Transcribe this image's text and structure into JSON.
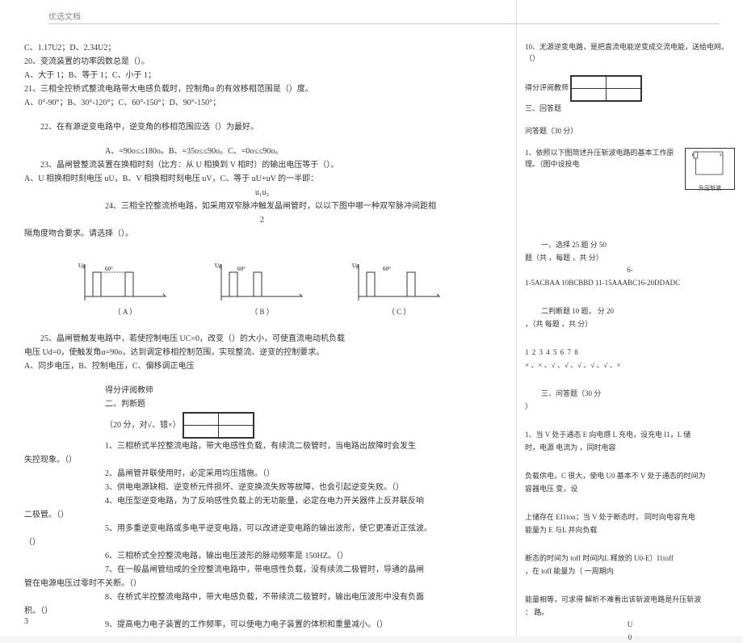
{
  "header": "优选文档",
  "page_number": "3",
  "left": {
    "l1": "C、1.17U2；D、2.34U2；",
    "l2": "20、变流装置的功率因数总是（）。",
    "l3": "A、大于 1；B、等于 1；C、小于 1；",
    "l4": "21、三相全控桥式整流电路带大电感负载时，控制角α 的有效移相范围是（）度。",
    "l5": "A、0°-90°；B、30°-120°；C、60°-150°；D、90°-150°；",
    "l6": "22、在有源逆变电路中，逆变角的移相范围应选（）为最好。",
    "l7": "A、=90o≤≤180o。B、=35o≤≤90o。C、=0o≤≤90o。",
    "l8": "23、晶闸管整流装置在换相时刻（比方：从 U 相换到 V 相时）的输出电压等于（）。",
    "l9": "A、U 相换相时刻电压 uU，B、V 相换相时刻电压 uV，C、等于 uU+uV 的一半即：",
    "l10": "u₁u₂",
    "l11": "24、三相全控整流桥电路，如采用双窄脉冲触发晶闸管时，以以下图中哪一种双窄脉冲间距相",
    "l11b": "隔角度吻合要求。请选择（）。",
    "diagA": "（ A ）",
    "diagB": "（ B ）",
    "diagC": "（ C ）",
    "l12a": "25、晶闸管触发电路中，若使控制电压 UC=0，改变（）的大小，可使直流电动机负载",
    "l12b": "电压 Ud=0，使触发角α=90o，达到调定移相控制范围，实现整流、逆变的控制要求。",
    "l13": "A、同步电压，B、控制电压，C、偏移调正电压",
    "score_label": "得分评阅教师",
    "sec2a": "二、判断题",
    "sec2b": "（20 分，对√、错×）",
    "t1a": "1、三相桥式半控整流电路，带大电感性负载，有续流二极管时，当电路出故障时会发生",
    "t1b": "失控现象。（）",
    "t2": "2、晶闸管并联使用时，必定采用均压措施。（）",
    "t3": "3、供电电源缺相、逆变桥元件损坏、逆变换流失败等故障，也会引起逆变失败。（）",
    "t4a": "4、电压型逆变电路，为了反响感性负载上的无功能量，必定在电力开关器件上反并联反响",
    "t4b": "二极管。（）",
    "t5a": "5、用多重逆变电路或多电平逆变电路，可以改进逆变电路的输出波形，使它更凑近正弦波。",
    "t5b": "（）",
    "t6": "6、三相桥式全控整流电路，输出电压波形的脉动频率是 150HZ。（）",
    "t7a": "7、在一般晶闸管组成的全控整流电路中，带电感性负载，没有续流二极管时，导通的晶闸",
    "t7b": "管在电源电压过零时不关断。（）",
    "t8a": "8、在桥式半控整流电路中，带大电感负载，不带续流二极管时，输出电压波形中没有负面",
    "t8b": "积。（）",
    "t9": "9、提高电力电子装置的工作频率，可以使电力电子装置的体积和重量减小。（）"
  },
  "right": {
    "l1": "10、无源逆变电路，是把直流电能逆变成交流电能，送给电网。（）",
    "score_label": "得分评阅教师",
    "sec3": "三、回答题",
    "sec3b": "问答题（30 分）",
    "q1": "1、依照以下图简述升压斩波电路的基本工作原理。（图中设投电",
    "diag_label": "升压斩波",
    "ans_sec1": "一、选择          25 题              分        50",
    "ans_sec1b": "题（共           ，每题              ，共 分）",
    "ans_line1": "6-",
    "ans_line2": "1-5ACBAA    10BCBBD          11-15AAABC16-20DDADC",
    "ans_sec2": "二判断题       10 题，          分        20",
    "ans_sec2b": "，（共         每题              ，共 分）",
    "ans_row_h": "1     2     3     4     5     6     7     8",
    "ans_row_v": "×  、×  、√  、√  、√  、√  、√  、×",
    "ans_sec3": "三、问答题（30 分",
    "ans_sec3b": "）",
    "p1a": "1、当 V 处于通态         E 向电感 L 充电，设充电       I1，L 储",
    "p1b": "时，电源                电流为                    ，同时电容",
    "p2a": "负载供电，C 很大，使电         U0 基本不 V 处于通态的时间为",
    "p2b": "容器电压                      变，设",
    "p3a": "上储存在         EI1ton；当 V 处于断态时，        同时向电容充电",
    "p3b": "能量为           E 与L                           并向负载",
    "p4a": "断态的时间为 toff       时间内L 释放的           U0-E）I1toff",
    "p4b": "，在 toff              能量为（                 一周期内",
    "p5a": "能量相等，可求得         解析不难看出该斩波电路是升压斩波",
    "p5b": "：                      路。",
    "p6": "U",
    "p7": "0"
  }
}
